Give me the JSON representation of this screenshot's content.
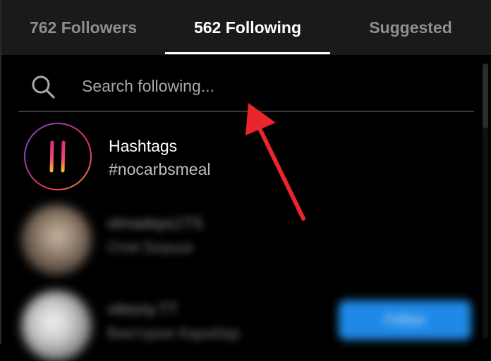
{
  "tabs": [
    {
      "label": "762 Followers",
      "active": false
    },
    {
      "label": "562 Following",
      "active": true
    },
    {
      "label": "Suggested",
      "active": false
    }
  ],
  "search": {
    "placeholder": "Search following...",
    "value": ""
  },
  "hashtags_entry": {
    "title": "Hashtags",
    "tag": "#nocarbsmeal"
  },
  "users": [
    {
      "username": "olmadeps1TS",
      "display_name": "Олеі Берши"
    },
    {
      "username": "viktoriy.TT",
      "display_name": "Виктория Карабар",
      "action_label": "Follow"
    }
  ],
  "colors": {
    "background": "#000000",
    "tabbar": "#1a1a1a",
    "active_text": "#ffffff",
    "inactive_text": "#8e8e8e",
    "follow_button": "#1e88e5",
    "annotation_arrow": "#e8262b"
  },
  "icons": [
    "search-icon",
    "hashtag-icon"
  ]
}
